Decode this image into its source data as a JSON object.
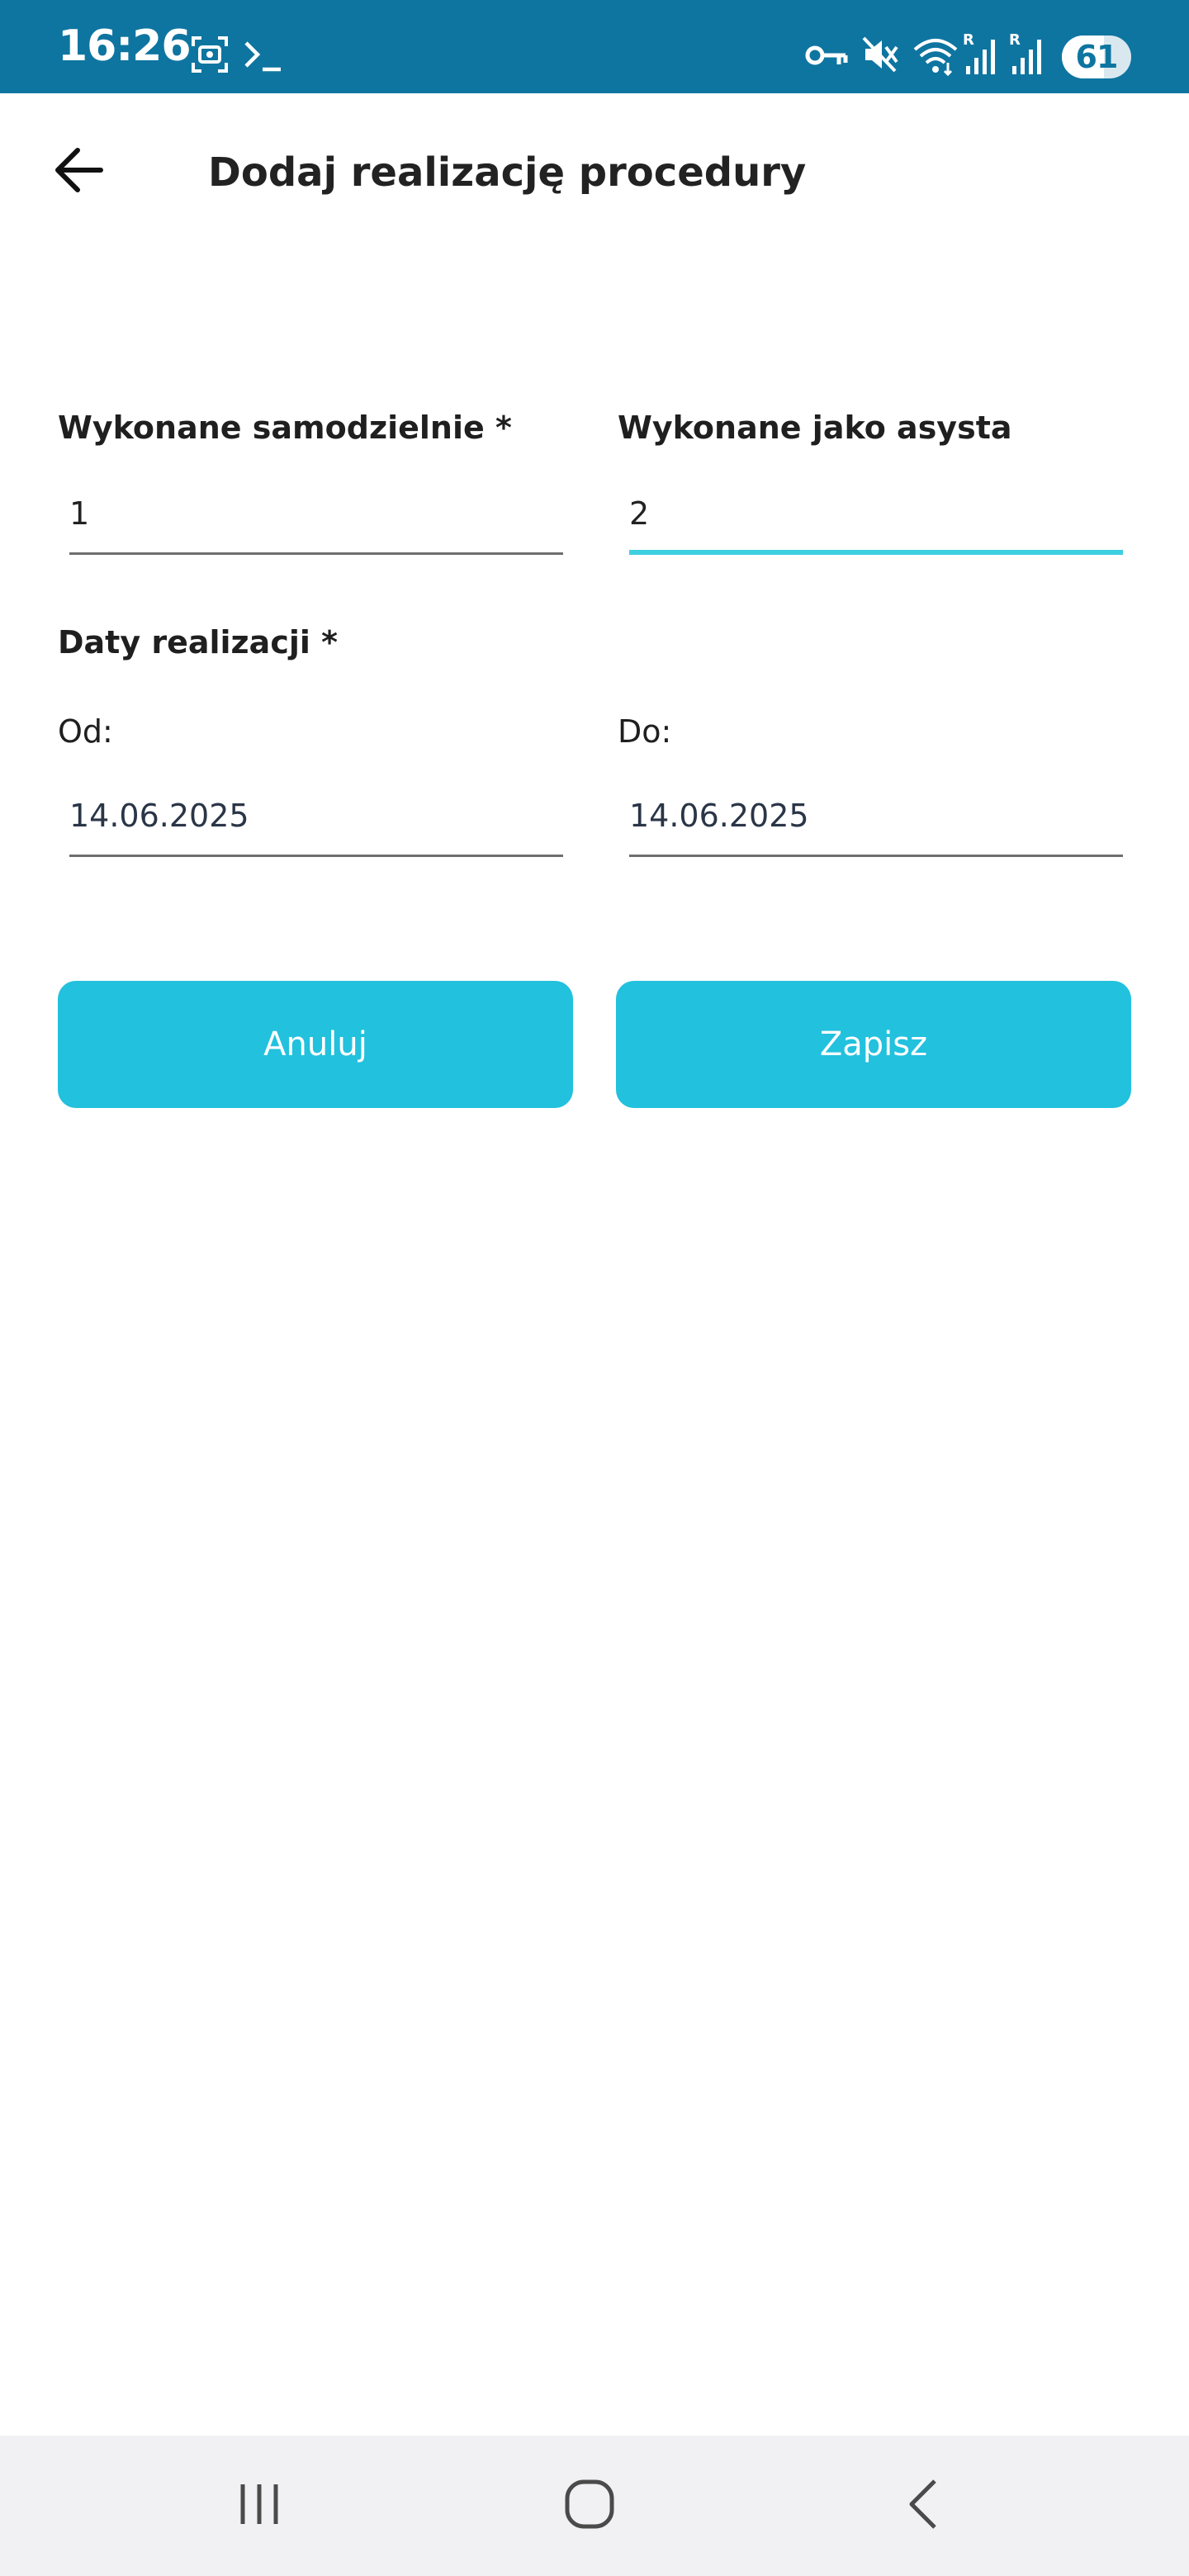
{
  "status_bar": {
    "time": "16:26",
    "battery_level": "61",
    "battery_fraction": 0.61,
    "icons": [
      "screenshot-icon",
      "terminal-icon",
      "vpn-key-icon",
      "mute-icon",
      "wifi-icon",
      "signal-icon",
      "signal-icon",
      "battery-icon"
    ],
    "signal_roaming_label": "R"
  },
  "header": {
    "title": "Dodaj realizację procedury",
    "back_icon": "arrow-left-icon"
  },
  "form": {
    "self_performed": {
      "label": "Wykonane samodzielnie *",
      "value": "1"
    },
    "assisted": {
      "label": "Wykonane jako asysta",
      "value": "2"
    },
    "dates_section_label": "Daty realizacji *",
    "date_from": {
      "label": "Od:",
      "value": "14.06.2025"
    },
    "date_to": {
      "label": "Do:",
      "value": "14.06.2025"
    }
  },
  "actions": {
    "cancel_label": "Anuluj",
    "save_label": "Zapisz"
  },
  "nav_bar": {
    "icons": [
      "recent-apps-icon",
      "home-icon",
      "back-icon"
    ]
  },
  "colors": {
    "status_bar": "#0e75a0",
    "accent": "#22c1de",
    "focus_underline": "#3ecfe0",
    "nav_bar": "#f1f1f3"
  }
}
